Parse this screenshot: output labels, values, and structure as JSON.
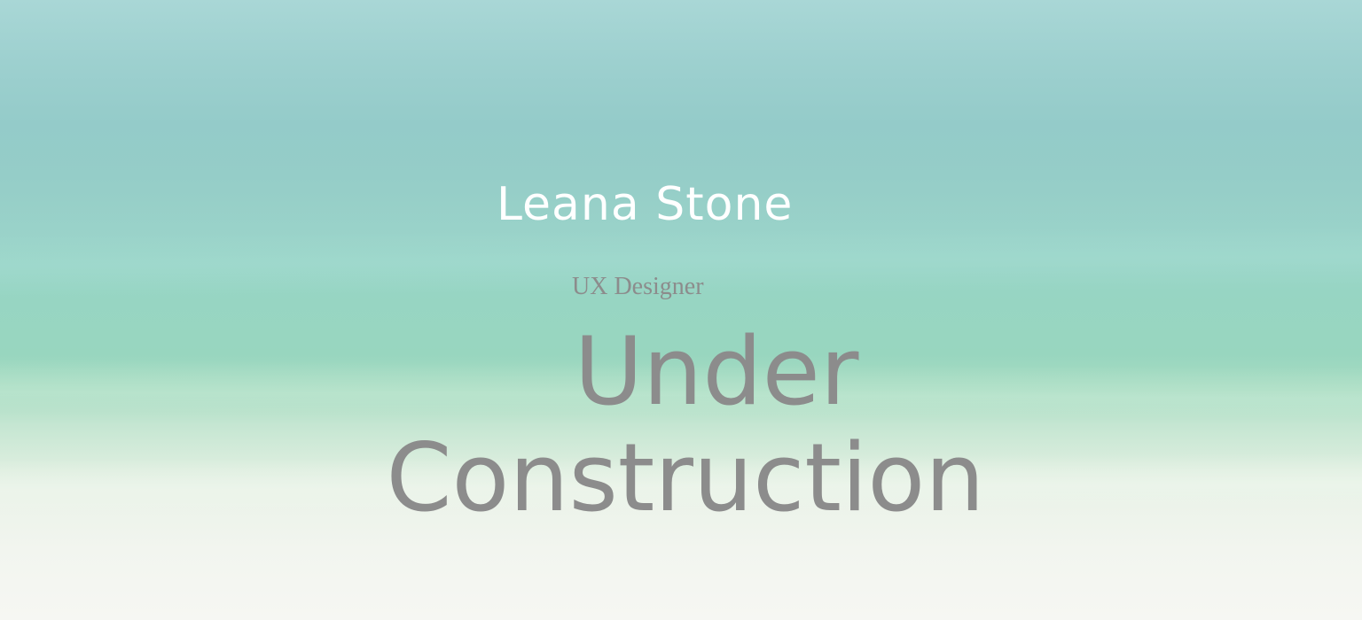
{
  "profile": {
    "name": "Leana Stone",
    "role": "UX Designer"
  },
  "status": {
    "line1": "Under",
    "line2": "Construction"
  },
  "colors": {
    "name_text": "#ffffff",
    "muted_text": "#8c8c8c",
    "top_teal": "#a9d7d6",
    "middle_green": "#98d6bf",
    "bottom_white": "#f6f7f3"
  }
}
